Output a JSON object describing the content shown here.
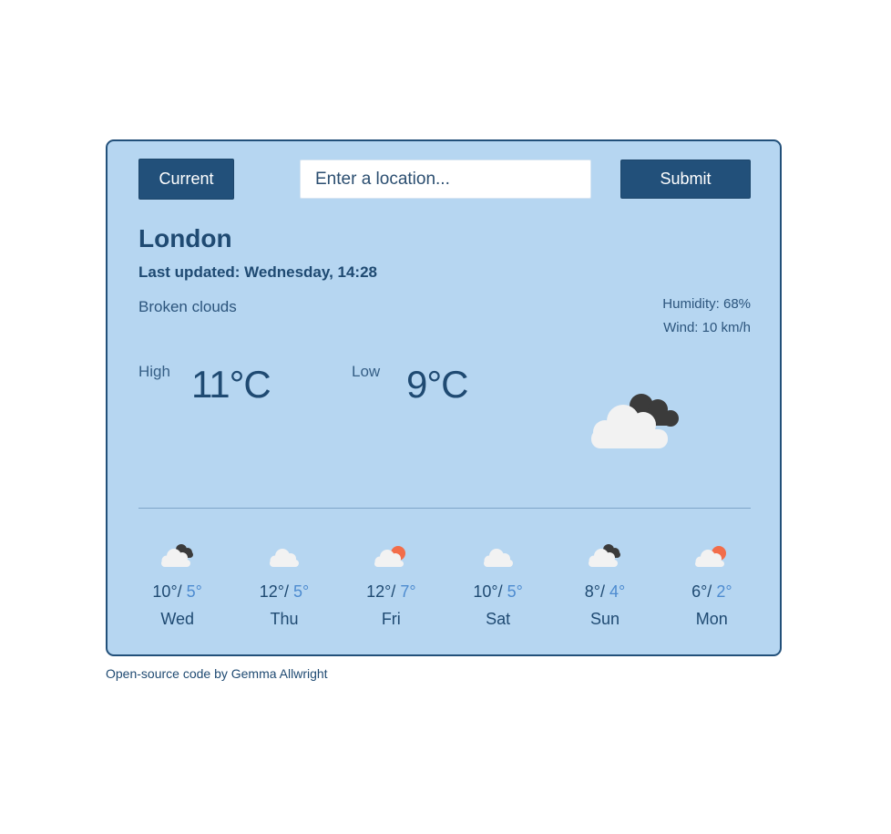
{
  "toolbar": {
    "current_label": "Current",
    "submit_label": "Submit",
    "search_placeholder": "Enter a location...",
    "search_value": ""
  },
  "weather": {
    "city": "London",
    "last_updated": "Last updated: Wednesday, 14:28",
    "description": "Broken clouds",
    "humidity": "Humidity: 68%",
    "wind": "Wind: 10 km/h",
    "high_label": "High",
    "high_value": "11°C",
    "low_label": "Low",
    "low_value": "9°C",
    "icon": "broken-clouds-icon"
  },
  "forecast": [
    {
      "day": "Wed",
      "high": "10°/",
      "low": "5°",
      "icon": "broken-clouds-icon"
    },
    {
      "day": "Thu",
      "high": "12°/",
      "low": "5°",
      "icon": "clouds-icon"
    },
    {
      "day": "Fri",
      "high": "12°/",
      "low": "7°",
      "icon": "sun-behind-cloud-icon"
    },
    {
      "day": "Sat",
      "high": "10°/",
      "low": "5°",
      "icon": "clouds-icon"
    },
    {
      "day": "Sun",
      "high": "8°/",
      "low": "4°",
      "icon": "broken-clouds-icon"
    },
    {
      "day": "Mon",
      "high": "6°/",
      "low": "2°",
      "icon": "sun-behind-cloud-icon"
    }
  ],
  "footer": {
    "text": "Open-source code by Gemma Allwright"
  },
  "colors": {
    "card_background": "#b6d6f1",
    "card_border": "#22507a",
    "button": "#22507a",
    "text_primary": "#1f4a72",
    "low_temp": "#4d8bd0",
    "sun": "#f26d4a",
    "light_cloud": "#f2f2f2",
    "dark_cloud": "#3b3b3b"
  }
}
